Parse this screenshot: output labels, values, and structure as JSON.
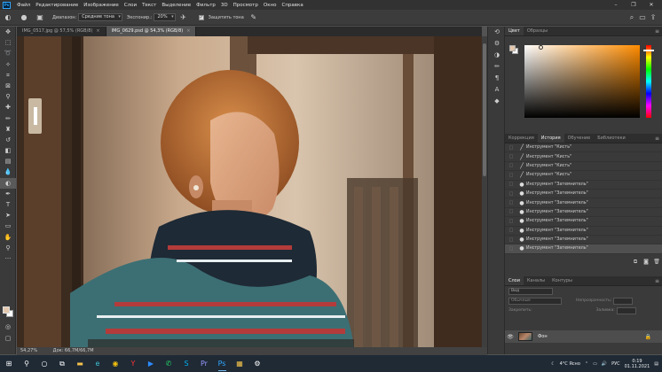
{
  "menu": {
    "items": [
      "Файл",
      "Редактирование",
      "Изображение",
      "Слои",
      "Текст",
      "Выделение",
      "Фильтр",
      "3D",
      "Просмотр",
      "Окно",
      "Справка"
    ]
  },
  "options": {
    "range_label": "Диапазон:",
    "range_value": "Средние тона",
    "exposure_label": "Экспонир.:",
    "exposure_value": "20%",
    "protect_label": "Защитить тона"
  },
  "tabs": [
    {
      "label": "IMG_0517.jpg @ 57,5% (RGB/8)",
      "active": false
    },
    {
      "label": "IMG_0629.psd @ 54,3% (RGB/8)",
      "active": true
    }
  ],
  "status": {
    "zoom": "54,27%",
    "doc": "Док: 66,7M/66,7M"
  },
  "color_panel": {
    "tabs": [
      "Цвет",
      "Образцы"
    ],
    "foreground": "#e4c8ad",
    "background": "#ffffff"
  },
  "history_panel": {
    "tabs": [
      "Коррекция",
      "История",
      "Обучение",
      "Библиотеки"
    ],
    "items": [
      {
        "label": "Инструмент \"Кисть\"",
        "icon": "brush-icon"
      },
      {
        "label": "Инструмент \"Кисть\"",
        "icon": "brush-icon"
      },
      {
        "label": "Инструмент \"Кисть\"",
        "icon": "brush-icon"
      },
      {
        "label": "Инструмент \"Кисть\"",
        "icon": "brush-icon"
      },
      {
        "label": "Инструмент \"Затемнитель\"",
        "icon": "burn-icon"
      },
      {
        "label": "Инструмент \"Затемнитель\"",
        "icon": "burn-icon"
      },
      {
        "label": "Инструмент \"Затемнитель\"",
        "icon": "burn-icon"
      },
      {
        "label": "Инструмент \"Затемнитель\"",
        "icon": "burn-icon"
      },
      {
        "label": "Инструмент \"Затемнитель\"",
        "icon": "burn-icon"
      },
      {
        "label": "Инструмент \"Затемнитель\"",
        "icon": "burn-icon"
      },
      {
        "label": "Инструмент \"Затемнитель\"",
        "icon": "burn-icon"
      },
      {
        "label": "Инструмент \"Затемнитель\"",
        "icon": "burn-icon"
      }
    ]
  },
  "layers_panel": {
    "tabs": [
      "Слои",
      "Каналы",
      "Контуры"
    ],
    "search_placeholder": "Вид",
    "blend_mode": "Обычные",
    "opacity_label": "Непрозрачность:",
    "lock_label": "Закрепить:",
    "fill_label": "Заливка:",
    "layer_name": "Фон"
  },
  "taskbar": {
    "weather": "4°C Ясно",
    "lang": "РУС",
    "time": "0:19",
    "date": "01.11.2021"
  }
}
